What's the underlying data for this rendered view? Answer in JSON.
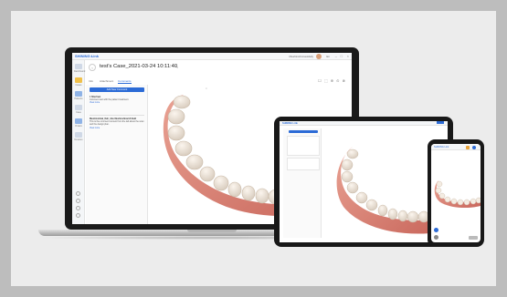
{
  "app": {
    "logo": "SHINING Link",
    "user_name": "Meshinshinnaoldafy",
    "language": "En",
    "case_title": "test's Case_2021-03-24 10:11:40",
    "tabs": [
      {
        "label": "Info"
      },
      {
        "label": "Attachment"
      },
      {
        "label": "Comments"
      }
    ],
    "sidebar": [
      {
        "label": "Dashboard",
        "color": "#cfd8e6"
      },
      {
        "label": "Cases",
        "color": "#f0c04a"
      },
      {
        "label": "Patients",
        "color": "#8fb3e6"
      },
      {
        "label": "Case",
        "color": "#cfd8e6"
      },
      {
        "label": "Orders",
        "color": "#8fb3e6"
      },
      {
        "label": "Devices",
        "color": "#cfd8e6"
      }
    ],
    "add_comment_label": "Add New Comment",
    "comments": [
      {
        "title": "1 Sherlnan",
        "body": "Comment text with the patient treatment.",
        "link": "View more"
      },
      {
        "title": "Meshinshinal_Deli_Abo Meshinshinal 2Lfield",
        "body": "This is the comment content from the lab about the scan and the design plan.",
        "link": "View more"
      }
    ],
    "toolbar_icons": "☐ ⬚ ⊕ ⊙ ⊗",
    "accent_color": "#2c6bd6"
  },
  "tablet": {
    "logo": "SHINING Link"
  },
  "phone": {
    "title": "SHINING Link"
  }
}
